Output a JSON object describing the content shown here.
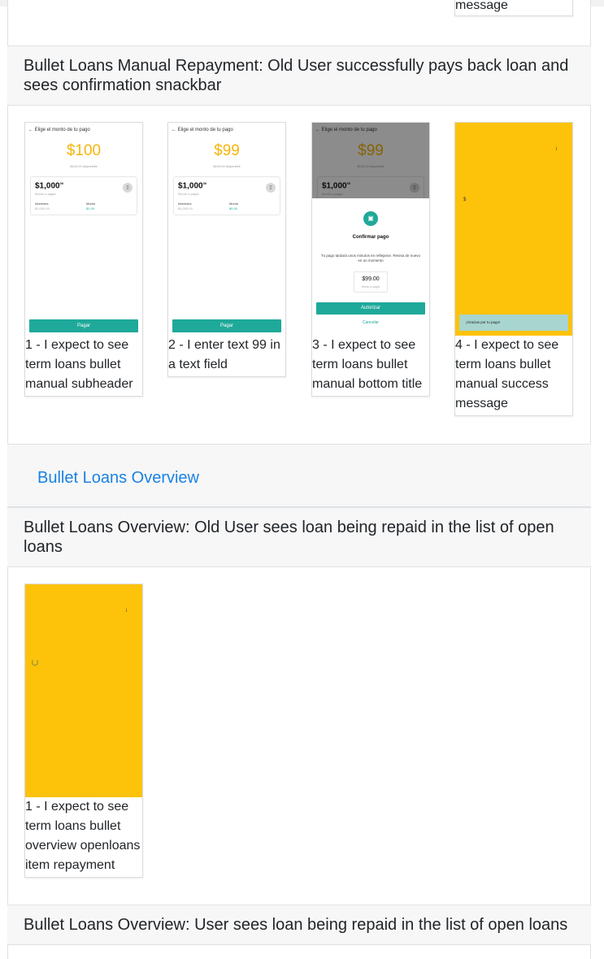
{
  "top_partial_caption": "message",
  "scenario1": {
    "title": "Bullet Loans Manual Repayment: Old User successfully pays back loan and sees confirmation snackbar",
    "steps": [
      {
        "caption": "1 - I expect to see term loans bullet manual subheader",
        "screen": {
          "back_title": "← Elige el monto de tu pago",
          "amount": "$100",
          "available": "$100.00 disponible",
          "card_amount": "$1,000",
          "card_cents": "00",
          "card_sub": "Monto a pagar",
          "interest_label": "Intereses",
          "interest_value": "$1,000.00",
          "amount_label": "Monto",
          "amount_value": "$1.00",
          "button": "Pagar"
        }
      },
      {
        "caption": "2 - I enter text 99 in a text field",
        "screen": {
          "back_title": "← Elige el monto de tu pago",
          "amount": "$99",
          "available": "$100.00 disponible",
          "card_amount": "$1,000",
          "card_cents": "00",
          "card_sub": "Monto a pagar",
          "interest_label": "Intereses",
          "interest_value": "$1,000.00",
          "amount_label": "Monto",
          "amount_value": "$0.00",
          "button": "Pagar"
        }
      },
      {
        "caption": "3 - I expect to see term loans bullet manual bottom title",
        "screen": {
          "back_title": "← Elige el monto de tu pago",
          "amount": "$99",
          "available": "$100.00 disponible",
          "card_amount": "$1,000",
          "card_cents": "00",
          "card_sub": "Monto a pagar",
          "sheet_title": "Confirmar pago",
          "sheet_text": "Tu pago tardará unos minutos en reflejarse. Revisa de nuevo en un momento",
          "sheet_amount": "$99.00",
          "sheet_amount_sub": "Monto a pagar",
          "authorize_button": "Autorizar",
          "cancel_link": "Cancelar"
        }
      },
      {
        "caption": "4 - I expect to see term loans bullet manual success message",
        "screen": {
          "dollar": "$",
          "corner_mark": "i",
          "snackbar": "¡Gracias por tu pago!"
        }
      }
    ]
  },
  "feature_link": "Bullet Loans Overview",
  "scenario2": {
    "title": "Bullet Loans Overview: Old User sees loan being repaid in the list of open loans",
    "steps": [
      {
        "caption": "1 - I expect to see term loans bullet overview openloans item repayment",
        "screen": {
          "corner_mark": "i"
        }
      }
    ]
  },
  "scenario3": {
    "title": "Bullet Loans Overview: User sees loan being repaid in the list of open loans"
  },
  "colors": {
    "brand_yellow": "#fdc20a",
    "teal": "#1fa99a",
    "link_blue": "#1a82e2",
    "header_bg": "#f7f7f7"
  }
}
